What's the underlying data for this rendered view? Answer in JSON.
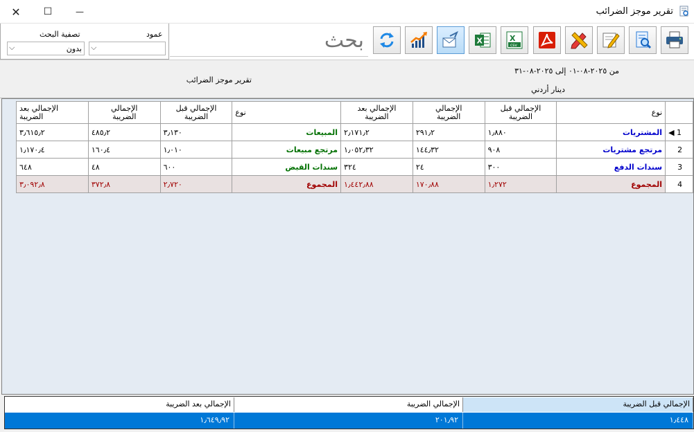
{
  "window": {
    "title": "تقرير موجز الضرائب",
    "close": "✕",
    "maximize": "☐",
    "minimize": "—"
  },
  "filter": {
    "column_label": "عمود",
    "column_value": "",
    "search_filter_label": "تصفية البحث",
    "search_filter_value": "بدون"
  },
  "search": {
    "placeholder": "بحث"
  },
  "toolbar": {
    "icons": [
      "print-icon",
      "preview-icon",
      "edit-icon",
      "design-icon",
      "pdf-icon",
      "csv-icon",
      "excel-icon",
      "email-icon",
      "chart-icon",
      "refresh-icon"
    ]
  },
  "info": {
    "date_range": "من ٢٠٢٥-٠٨-٠١ إلى ٢٠٢٥-٠٨-٣١",
    "report_title": "تقرير موجز الضرائب",
    "currency": "دينار أردني"
  },
  "table": {
    "headers": {
      "type": "نوع",
      "before_tax": [
        "الإجمالي قبل",
        "الضريبة"
      ],
      "tax": [
        "الإجمالي",
        "الضريبة"
      ],
      "after_tax": [
        "الإجمالي بعد",
        "الضريبة"
      ]
    },
    "rows": [
      {
        "num": "1",
        "type1": "المشتريات",
        "b1": "١٫٨٨٠",
        "t1": "٢٩١٫٢",
        "a1": "٢٫١٧١٫٢",
        "type2": "المبيعات",
        "b2": "٣٫١٣٠",
        "t2": "٤٨٥٫٢",
        "a2": "٣٫٦١٥٫٢"
      },
      {
        "num": "2",
        "type1": "مرتجع مشتريات",
        "b1": "٩٠٨",
        "t1": "١٤٤٫٣٢",
        "a1": "١٫٠٥٢٫٣٢",
        "type2": "مرتجع مبيعات",
        "b2": "١٫٠١٠",
        "t2": "١٦٠٫٤",
        "a2": "١٫١٧٠٫٤"
      },
      {
        "num": "3",
        "type1": "سندات الدفع",
        "b1": "٣٠٠",
        "t1": "٢٤",
        "a1": "٣٢٤",
        "type2": "سندات القبض",
        "b2": "٦٠٠",
        "t2": "٤٨",
        "a2": "٦٤٨"
      },
      {
        "num": "4",
        "type1": "المجموع",
        "b1": "١٫٢٧٢",
        "t1": "١٧٠٫٨٨",
        "a1": "١٫٤٤٢٫٨٨",
        "type2": "المجموع",
        "b2": "٢٫٧٢٠",
        "t2": "٣٧٢٫٨",
        "a2": "٣٫٠٩٢٫٨"
      }
    ]
  },
  "summary": {
    "before_tax_label": "الإجمالي قبل الضريبة",
    "tax_label": "الإجمالي الضريبة",
    "after_tax_label": "الإجمالي بعد الضريبة",
    "before_tax_value": "١٫٤٤٨",
    "tax_value": "٢٠١٫٩٢",
    "after_tax_value": "١٫٦٤٩٫٩٢"
  },
  "colors": {
    "accent": "#0078d7",
    "total_row": "#e9e1e1",
    "total_text": "#a00000",
    "purchase_text": "#0000cc",
    "sales_text": "#007000"
  }
}
